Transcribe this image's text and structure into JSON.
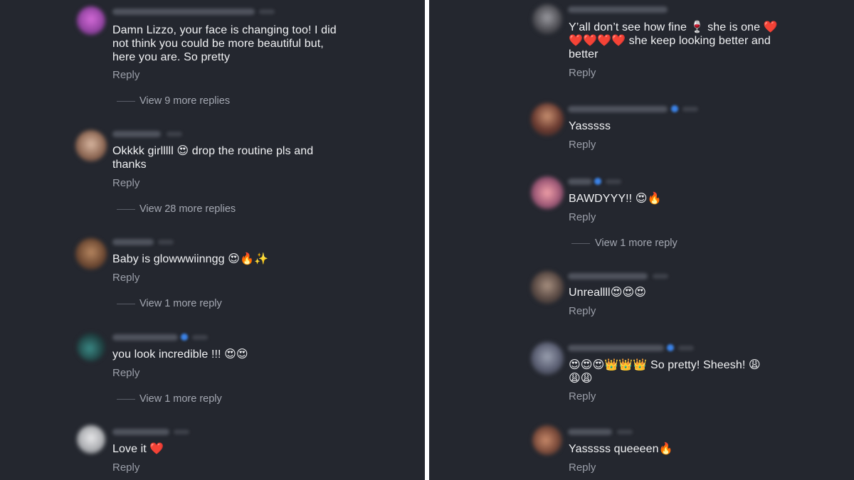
{
  "left_comments": [
    {
      "text": "Damn Lizzo, your face is changing too! I did\nnot think you could be more beautiful but,\nhere you are. So pretty",
      "reply": "Reply",
      "more": "View 9 more replies"
    },
    {
      "text": "Okkkk girlllll 😍 drop the routine pls and\nthanks",
      "reply": "Reply",
      "more": "View 28 more replies"
    },
    {
      "text": "Baby is glowwwiinngg 😍🔥✨",
      "reply": "Reply",
      "more": "View 1 more reply"
    },
    {
      "text": "you look incredible !!! 😍😍",
      "reply": "Reply",
      "more": "View 1 more reply"
    },
    {
      "text": "Love it ❤️",
      "reply": "Reply"
    }
  ],
  "right_comments": [
    {
      "text": "Y’all don’t see how fine 🍷 she is one ❤️\n❤️❤️❤️❤️ she keep looking better and\nbetter",
      "reply": "Reply"
    },
    {
      "text": "Yasssss",
      "reply": "Reply"
    },
    {
      "text": "BAWDYYY!! 😍🔥",
      "reply": "Reply",
      "more": "View 1 more reply"
    },
    {
      "text": "Unreallll😍😍😍",
      "reply": "Reply"
    },
    {
      "text": "😍😍😍👑👑👑 So pretty! Sheesh! 😩\n😩😩",
      "reply": "Reply"
    },
    {
      "text": "Yasssss queeeen🔥",
      "reply": "Reply"
    }
  ],
  "colors": {
    "background": "#24272f",
    "text": "#f2f3f5",
    "secondary_text": "#9a9ea8",
    "verified": "#3b82e6",
    "divider": "#ffffff"
  }
}
